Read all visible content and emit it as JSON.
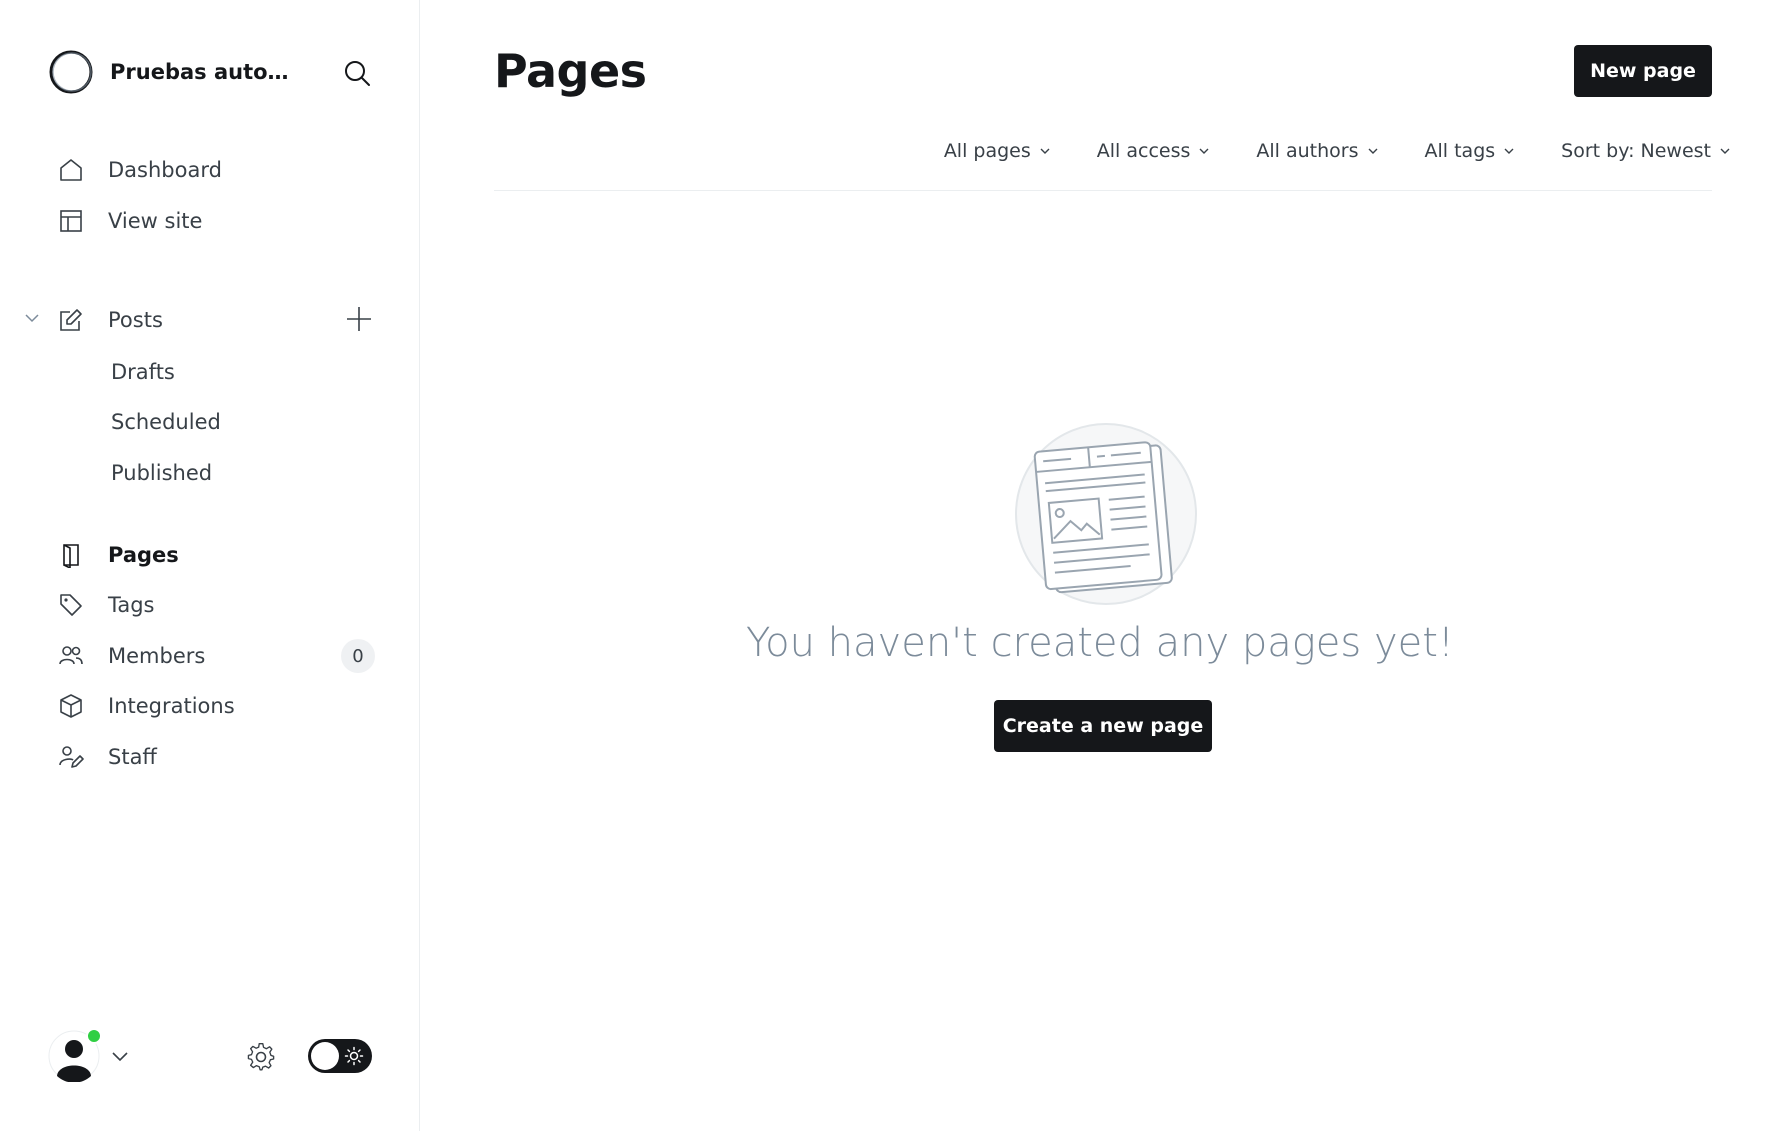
{
  "sidebar": {
    "site_name": "Pruebas automa...",
    "nav": {
      "dashboard": "Dashboard",
      "view_site": "View site",
      "posts": "Posts",
      "drafts": "Drafts",
      "scheduled": "Scheduled",
      "published": "Published",
      "pages": "Pages",
      "tags": "Tags",
      "members": "Members",
      "members_count": "0",
      "integrations": "Integrations",
      "staff": "Staff"
    },
    "icons": [
      "search-icon",
      "home-icon",
      "layout-icon",
      "edit-icon",
      "plus-icon",
      "page-icon",
      "tag-icon",
      "members-icon",
      "cube-icon",
      "staff-icon",
      "gear-icon",
      "sun-icon"
    ]
  },
  "main": {
    "title": "Pages",
    "new_page_label": "New page",
    "filters": {
      "type": "All pages",
      "access": "All access",
      "authors": "All authors",
      "tags": "All tags",
      "sort": "Sort by: Newest"
    },
    "empty": {
      "message": "You haven't created any pages yet!",
      "cta": "Create a new page"
    }
  },
  "colors": {
    "primary": "#15171a",
    "online": "#30cf43",
    "muted_text": "#7c8b9a",
    "divider": "#ebeef0"
  }
}
